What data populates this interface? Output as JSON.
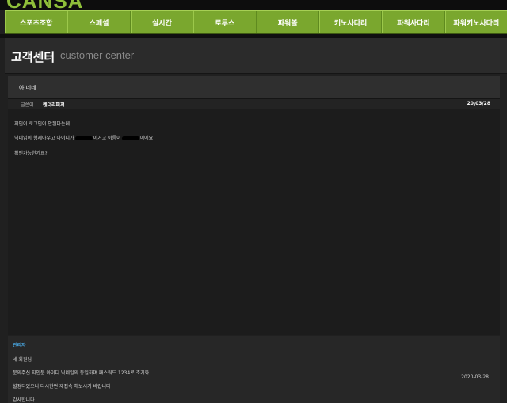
{
  "brand": {
    "logo": "CANSA"
  },
  "nav": [
    "스포츠조합",
    "스페셜",
    "실시간",
    "로투스",
    "파워볼",
    "키노사다리",
    "파워사다리",
    "파워키노사다리"
  ],
  "page": {
    "title": "고객센터",
    "subtitle": "customer center"
  },
  "post": {
    "title": "아 네네",
    "author_label": "글쓴이",
    "author": "렌더리퍼저",
    "date": "20/03/28",
    "body": {
      "line1": "지인이 로그인이 안된다는데",
      "line2a": "닉네임이 헝제아우고 아이디가",
      "line2b": "이거고 이름이",
      "line2c": "이에요",
      "line3": "확인가능한가요?"
    }
  },
  "reply": {
    "author": "관리자",
    "lines": [
      "네 회원님",
      "문의주신 지인분 아이디 닉네임의 동일하며 패스워드 1234로 조기화",
      "설정되었으니 다시한번 재접속 해보시기 바랍니다",
      "감사합니다."
    ],
    "date": "2020-03-28"
  }
}
